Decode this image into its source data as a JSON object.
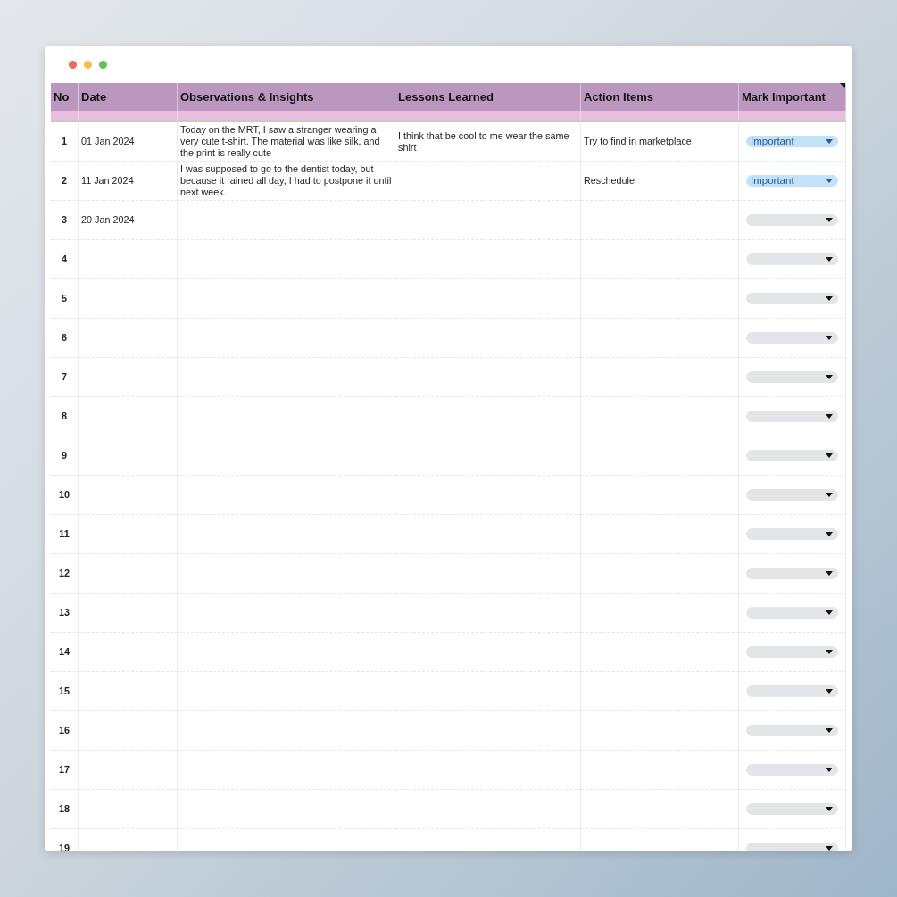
{
  "table": {
    "columns": [
      "No",
      "Date",
      "Observations & Insights",
      "Lessons Learned",
      "Action Items",
      "Mark Important"
    ],
    "rows": [
      {
        "no": "1",
        "date": "01 Jan 2024",
        "observation": "Today on the MRT, I saw a stranger wearing a very cute t-shirt. The material was like silk, and the print is really cute",
        "lesson": "I think that be cool to me wear the same shirt",
        "action": "Try to find in marketplace",
        "mark": {
          "marked": true,
          "label": "Important"
        }
      },
      {
        "no": "2",
        "date": "11 Jan 2024",
        "observation": "I was supposed to go to the dentist today, but because it rained all day, I had to postpone it until next week.",
        "action": "Reschedule",
        "mark": {
          "marked": true,
          "label": "Important"
        }
      },
      {
        "no": "3",
        "date": "20 Jan 2024",
        "mark": {
          "marked": false
        }
      },
      {
        "no": "4",
        "mark": {
          "marked": false
        }
      },
      {
        "no": "5",
        "mark": {
          "marked": false
        }
      },
      {
        "no": "6",
        "mark": {
          "marked": false
        }
      },
      {
        "no": "7",
        "mark": {
          "marked": false
        }
      },
      {
        "no": "8",
        "mark": {
          "marked": false
        }
      },
      {
        "no": "9",
        "mark": {
          "marked": false
        }
      },
      {
        "no": "10",
        "mark": {
          "marked": false
        }
      },
      {
        "no": "11",
        "mark": {
          "marked": false
        }
      },
      {
        "no": "12",
        "mark": {
          "marked": false
        }
      },
      {
        "no": "13",
        "mark": {
          "marked": false
        }
      },
      {
        "no": "14",
        "mark": {
          "marked": false
        }
      },
      {
        "no": "15",
        "mark": {
          "marked": false
        }
      },
      {
        "no": "16",
        "mark": {
          "marked": false
        }
      },
      {
        "no": "17",
        "mark": {
          "marked": false
        }
      },
      {
        "no": "18",
        "mark": {
          "marked": false
        }
      },
      {
        "no": "19",
        "mark": {
          "marked": false
        }
      }
    ]
  }
}
